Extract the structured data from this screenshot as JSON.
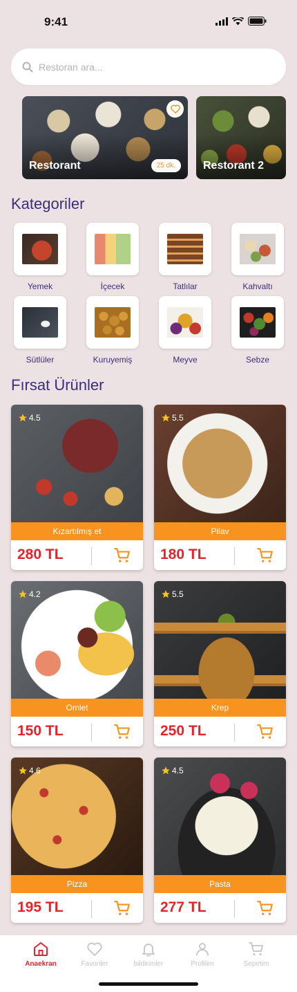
{
  "status_bar": {
    "time": "9:41"
  },
  "search": {
    "placeholder": "Restoran ara..."
  },
  "restaurants": [
    {
      "name": "Restorant",
      "time": "25 dk."
    },
    {
      "name": "Restorant 2"
    }
  ],
  "categories_title": "Kategoriler",
  "categories": [
    {
      "label": "Yemek"
    },
    {
      "label": "İçecek"
    },
    {
      "label": "Tatlılar"
    },
    {
      "label": "Kahvaltı"
    },
    {
      "label": "Sütlüler"
    },
    {
      "label": "Kuruyemiş"
    },
    {
      "label": "Meyve"
    },
    {
      "label": "Sebze"
    }
  ],
  "deals_title": "Fırsat Ürünler",
  "products": [
    {
      "name": "Kızartılmış et",
      "price": "280 TL",
      "rating": "4.5"
    },
    {
      "name": "Pilav",
      "price": "180 TL",
      "rating": "5.5"
    },
    {
      "name": "Omlet",
      "price": "150 TL",
      "rating": "4.2"
    },
    {
      "name": "Krep",
      "price": "250 TL",
      "rating": "5.5"
    },
    {
      "name": "Pizza",
      "price": "195 TL",
      "rating": "4.6"
    },
    {
      "name": "Pasta",
      "price": "277 TL",
      "rating": "4.5"
    }
  ],
  "bottom_nav": [
    {
      "label": "Anaekran",
      "icon": "home-icon",
      "active": true
    },
    {
      "label": "Favoriler",
      "icon": "heart-icon"
    },
    {
      "label": "bildirimler",
      "icon": "bell-icon"
    },
    {
      "label": "Profilim",
      "icon": "user-icon"
    },
    {
      "label": "Sepetim",
      "icon": "cart-icon"
    }
  ],
  "colors": {
    "accent": "#f7931e",
    "price": "#e0262c",
    "title": "#3b2d7a",
    "background": "#ece2e4"
  }
}
